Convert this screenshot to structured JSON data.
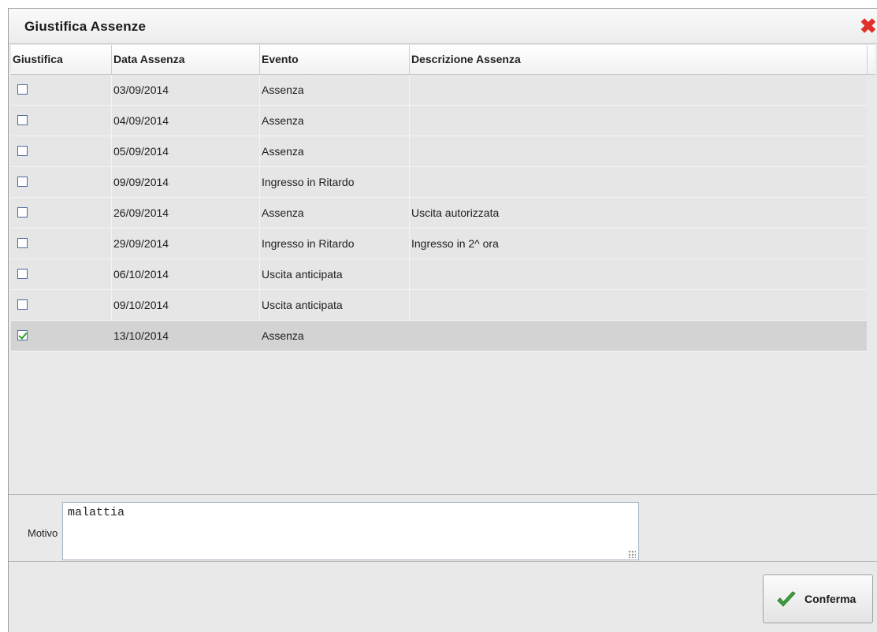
{
  "dialog": {
    "title": "Giustifica Assenze",
    "close_icon": "close-x-icon"
  },
  "table": {
    "columns": [
      "Giustifica",
      "Data Assenza",
      "Evento",
      "Descrizione Assenza"
    ],
    "rows": [
      {
        "checked": false,
        "date": "03/09/2014",
        "event": "Assenza",
        "description": ""
      },
      {
        "checked": false,
        "date": "04/09/2014",
        "event": "Assenza",
        "description": ""
      },
      {
        "checked": false,
        "date": "05/09/2014",
        "event": "Assenza",
        "description": ""
      },
      {
        "checked": false,
        "date": "09/09/2014",
        "event": "Ingresso in Ritardo",
        "description": ""
      },
      {
        "checked": false,
        "date": "26/09/2014",
        "event": "Assenza",
        "description": "Uscita autorizzata"
      },
      {
        "checked": false,
        "date": "29/09/2014",
        "event": "Ingresso in Ritardo",
        "description": "Ingresso in 2^ ora"
      },
      {
        "checked": false,
        "date": "06/10/2014",
        "event": "Uscita anticipata",
        "description": ""
      },
      {
        "checked": false,
        "date": "09/10/2014",
        "event": "Uscita anticipata",
        "description": ""
      },
      {
        "checked": true,
        "date": "13/10/2014",
        "event": "Assenza",
        "description": "",
        "selected": true
      }
    ]
  },
  "motivo": {
    "label": "Motivo",
    "value": "malattia"
  },
  "confirm": {
    "label": "Conferma",
    "icon": "checkmark-icon"
  },
  "colors": {
    "close": "#e0322b",
    "check": "#2aa02a"
  }
}
